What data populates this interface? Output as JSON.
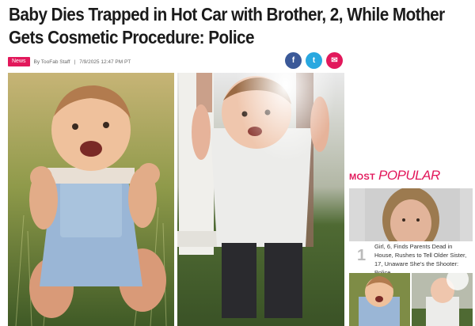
{
  "article": {
    "headline": "Baby Dies Trapped in Hot Car with Brother, 2, While Mother Gets Cosmetic Procedure: Police",
    "badge": "News",
    "byline": "By TooFab Staff",
    "separator": "|",
    "date": "7/9/2025 12:47 PM PT"
  },
  "share": {
    "facebook_icon": "f",
    "twitter_icon": "t",
    "email_icon": "✉"
  },
  "sidebar": {
    "most_label": "MOST",
    "popular_label": "POPULAR",
    "item_number": "1",
    "item_title": "Girl, 6, Finds Parents Dead in House, Rushes to Tell Older Sister, 17, Unaware She's the Shooter: Police"
  },
  "colors": {
    "accent": "#e2185b",
    "facebook": "#3b5998",
    "twitter": "#29a8e0"
  }
}
